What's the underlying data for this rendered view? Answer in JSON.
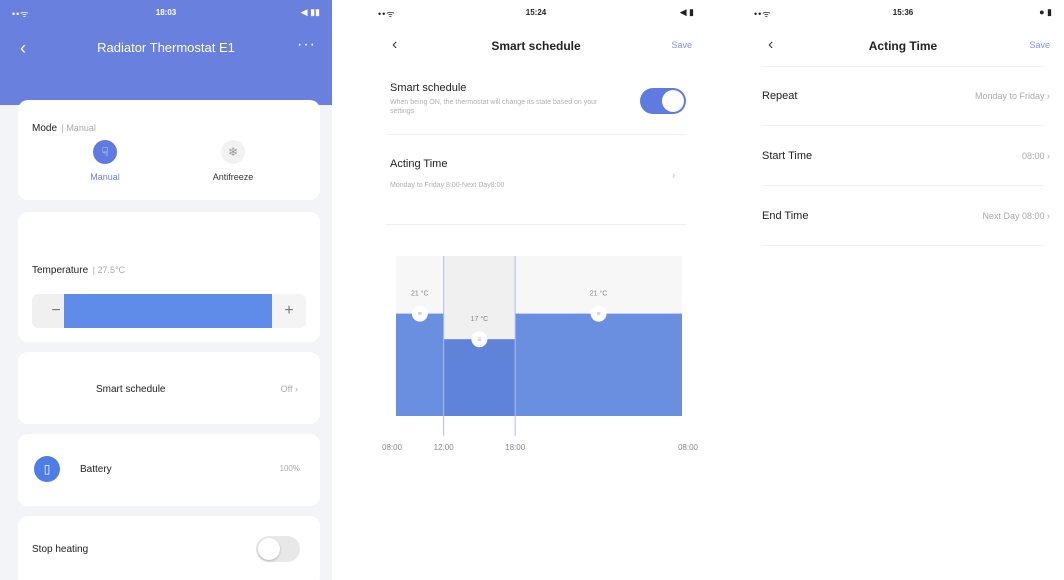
{
  "screen1": {
    "status": {
      "time": "18:03",
      "signal": "••ᯤ",
      "battery": "◀ ▮▮"
    },
    "title": "Radiator Thermostat E1",
    "mode": {
      "label": "Mode",
      "value": "Manual",
      "options": [
        {
          "label": "Manual",
          "icon": "hand-icon",
          "active": true
        },
        {
          "label": "Antifreeze",
          "icon": "snowflake-icon",
          "active": false
        }
      ]
    },
    "temperature": {
      "label": "Temperature",
      "value": "27.5°C",
      "minus": "−",
      "plus": "+",
      "level_percent": 100
    },
    "smart_schedule": {
      "label": "Smart schedule",
      "value": "Off",
      "chevron": "›"
    },
    "battery": {
      "label": "Battery",
      "value": "100%"
    },
    "stop_heating": {
      "label": "Stop heating",
      "on": false
    }
  },
  "screen2": {
    "status": {
      "time": "15:24",
      "signal": "••ᯤ",
      "battery": "◀ ▮"
    },
    "title": "Smart schedule",
    "save": "Save",
    "smart_schedule": {
      "label": "Smart schedule",
      "description": "When being ON, the thermostat will change its state based on your settings",
      "on": true
    },
    "acting_time": {
      "label": "Acting Time",
      "value": "Monday to Friday 8:00-Next Day8:00",
      "chevron": "›"
    }
  },
  "screen3": {
    "status": {
      "time": "15:36",
      "signal": "••ᯤ",
      "battery": "● ▮"
    },
    "title": "Acting Time",
    "save": "Save",
    "rows": [
      {
        "label": "Repeat",
        "value": "Monday to Friday",
        "chevron": "›"
      },
      {
        "label": "Start Time",
        "value": "08:00",
        "chevron": "›"
      },
      {
        "label": "End Time",
        "value": "Next Day 08:00",
        "chevron": "›"
      }
    ]
  },
  "chart_data": {
    "type": "bar",
    "categories": [
      "08:00–12:00",
      "12:00–18:00",
      "18:00–08:00"
    ],
    "x_ticks": [
      "08:00",
      "12:00",
      "18:00",
      "08:00"
    ],
    "segments": [
      {
        "start_hour": 8,
        "end_hour": 12,
        "value": 21,
        "label": "21 °C"
      },
      {
        "start_hour": 12,
        "end_hour": 18,
        "value": 17,
        "label": "17 °C"
      },
      {
        "start_hour": 18,
        "end_hour": 32,
        "value": 21,
        "label": "21 °C"
      }
    ],
    "xlim": [
      8,
      32
    ],
    "ylim": [
      5,
      30
    ],
    "highlighted_segment": 1,
    "grid": false,
    "colors": {
      "bar": "#6b8fe0",
      "bar_dark": "#5f83d9",
      "highlight_bg": "#f0f0f0",
      "label": "#888888"
    }
  }
}
